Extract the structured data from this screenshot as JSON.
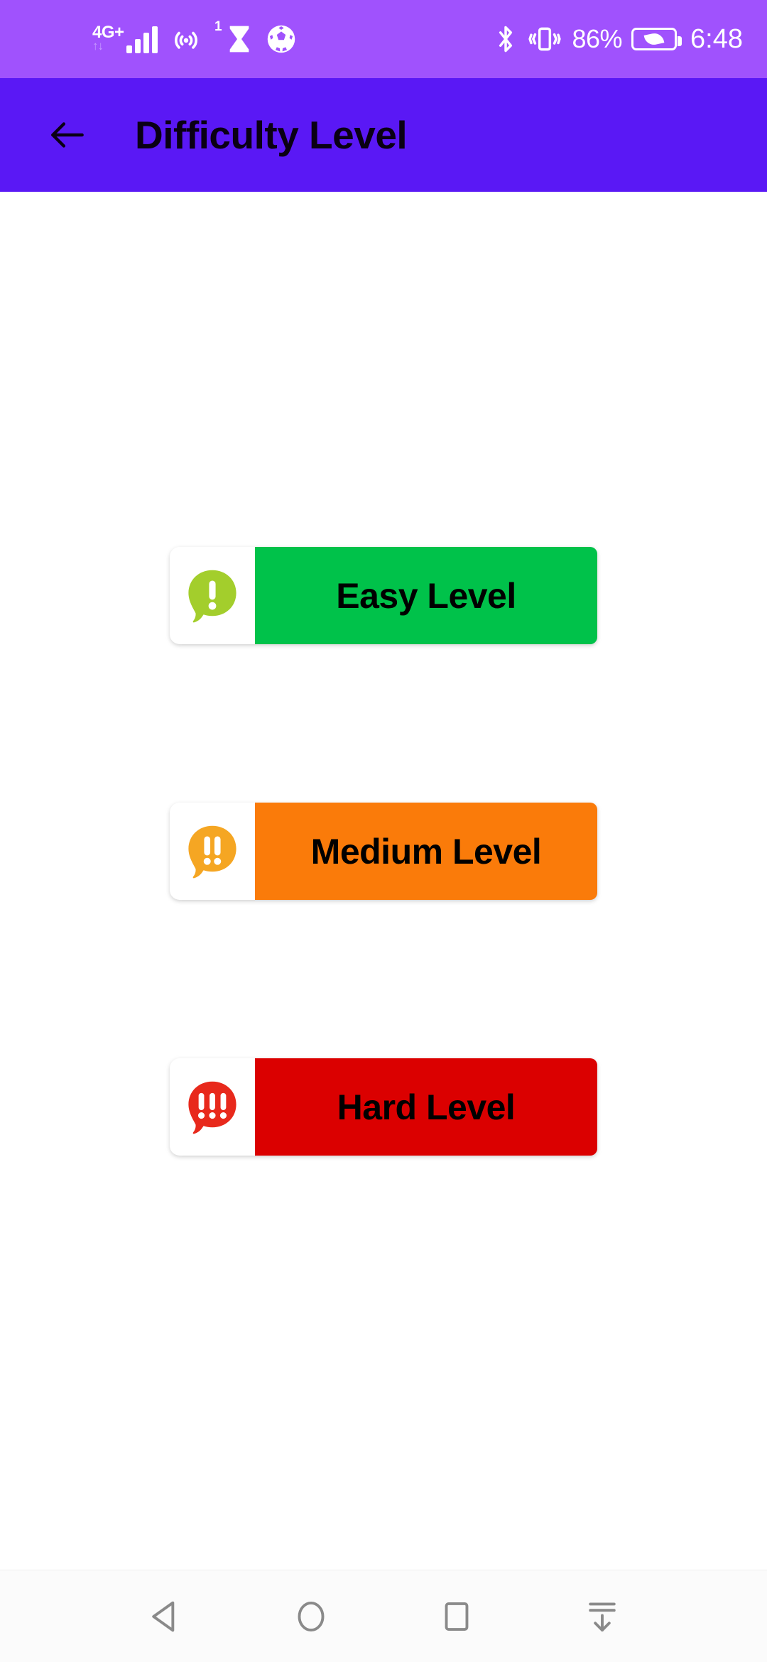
{
  "status_bar": {
    "background_color": "#a052fd",
    "network_type": "4G+",
    "data_arrows": "↑↓",
    "signal_icon": "signal-bars-icon",
    "hotspot_icon": "hotspot-icon",
    "hotspot_superscript": "1",
    "hourglass_icon": "hourglass-icon",
    "football_icon": "football-icon",
    "bluetooth_icon": "bluetooth-icon",
    "vibrate_icon": "vibrate-icon",
    "battery_percent": "86%",
    "battery_icon": "battery-power-saving-icon",
    "time": "6:48"
  },
  "app_bar": {
    "background_color": "#5a18f5",
    "back_icon": "arrow-left-icon",
    "title": "Difficulty Level",
    "title_color": "#0a0014"
  },
  "levels": [
    {
      "id": "easy",
      "label": "Easy Level",
      "button_color": "#00c24a",
      "bubble_color": "#a3ce2c",
      "bubble_icon": "alert-bubble-icon",
      "marks": "!",
      "mark_count": 1
    },
    {
      "id": "medium",
      "label": "Medium Level",
      "button_color": "#fa7b0a",
      "bubble_color": "#f5a623",
      "bubble_icon": "alert-bubble-icon",
      "marks": "!!",
      "mark_count": 2
    },
    {
      "id": "hard",
      "label": "Hard Level",
      "button_color": "#db0000",
      "bubble_color": "#e8291c",
      "bubble_icon": "alert-bubble-icon",
      "marks": "!!!",
      "mark_count": 3
    }
  ],
  "nav_bar": {
    "background_color": "#fbfbfb",
    "icon_color": "#8a8a8a",
    "buttons": [
      {
        "name": "back",
        "icon": "triangle-back-icon"
      },
      {
        "name": "home",
        "icon": "circle-home-icon"
      },
      {
        "name": "recents",
        "icon": "square-recents-icon"
      },
      {
        "name": "hide-keyboard",
        "icon": "arrow-down-hide-icon"
      }
    ]
  }
}
